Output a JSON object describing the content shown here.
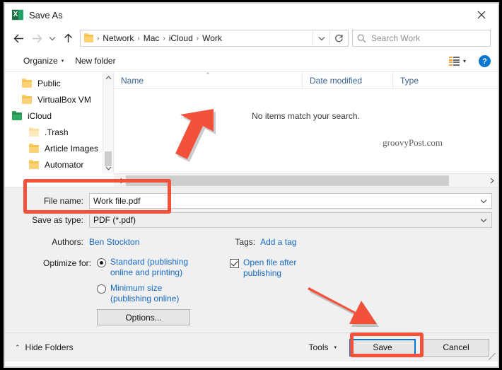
{
  "window": {
    "title": "Save As",
    "app_icon": "excel-icon",
    "close_label": "✕"
  },
  "nav": {
    "back_icon": "arrow-left-icon",
    "forward_icon": "arrow-right-icon",
    "recent_icon": "chevron-down-icon",
    "up_icon": "arrow-up-icon",
    "refresh_icon": "refresh-icon",
    "address_chevron_icon": "chevron-down-icon",
    "breadcrumbs": [
      "Network",
      "Mac",
      "iCloud",
      "Work"
    ],
    "separator": "›"
  },
  "search": {
    "placeholder": "Search Work",
    "icon": "search-icon"
  },
  "commandbar": {
    "organize_label": "Organize",
    "organize_caret": "▾",
    "new_folder_label": "New folder",
    "view_icon": "view-options-icon",
    "view_caret": "▾",
    "help_label": "?"
  },
  "sidebar": {
    "items": [
      {
        "label": "Public",
        "icon": "folder-icon",
        "level": 1
      },
      {
        "label": "VirtualBox VM",
        "icon": "folder-icon",
        "level": 1
      },
      {
        "label": "iCloud",
        "icon": "network-drive-icon",
        "level": 0
      },
      {
        "label": ".Trash",
        "icon": "folder-dim-icon",
        "level": 2
      },
      {
        "label": "Article Images",
        "icon": "folder-icon",
        "level": 2
      },
      {
        "label": "Automator",
        "icon": "folder-icon",
        "level": 2
      }
    ],
    "scroll_up_icon": "chevron-up-icon",
    "scroll_down_icon": "chevron-down-icon"
  },
  "filelist": {
    "columns": [
      "Name",
      "Date modified",
      "Type"
    ],
    "sort_caret": "⌃",
    "empty_message": "No items match your search.",
    "watermark": "groovyPost.com",
    "rows": [],
    "hscroll_left_icon": "chevron-left-icon",
    "hscroll_right_icon": "chevron-right-icon"
  },
  "form": {
    "file_name_label": "File name:",
    "file_name_value": "Work file.pdf",
    "save_as_type_label": "Save as type:",
    "save_as_type_value": "PDF (*.pdf)",
    "combo_chevron": "⌄",
    "authors_label": "Authors:",
    "authors_value": "Ben Stockton",
    "tags_label": "Tags:",
    "tags_value": "Add a tag",
    "optimize_label": "Optimize for:",
    "radio_standard": "Standard (publishing online and printing)",
    "radio_standard_selected": true,
    "radio_minimum": "Minimum size (publishing online)",
    "radio_minimum_selected": false,
    "options_button": "Options...",
    "open_after_label": "Open file after publishing",
    "open_after_checked": true
  },
  "footer": {
    "hide_folders_label": "Hide Folders",
    "hide_folders_caret": "⌃",
    "tools_label": "Tools",
    "tools_caret": "▾",
    "save_label": "Save",
    "cancel_label": "Cancel"
  },
  "annotations": {
    "accent_color": "#f4513b",
    "highlight_filename_box": true,
    "highlight_save_button": true,
    "arrow_to_filename": "red-arrow-icon",
    "arrow_to_save": "red-arrow-icon"
  }
}
